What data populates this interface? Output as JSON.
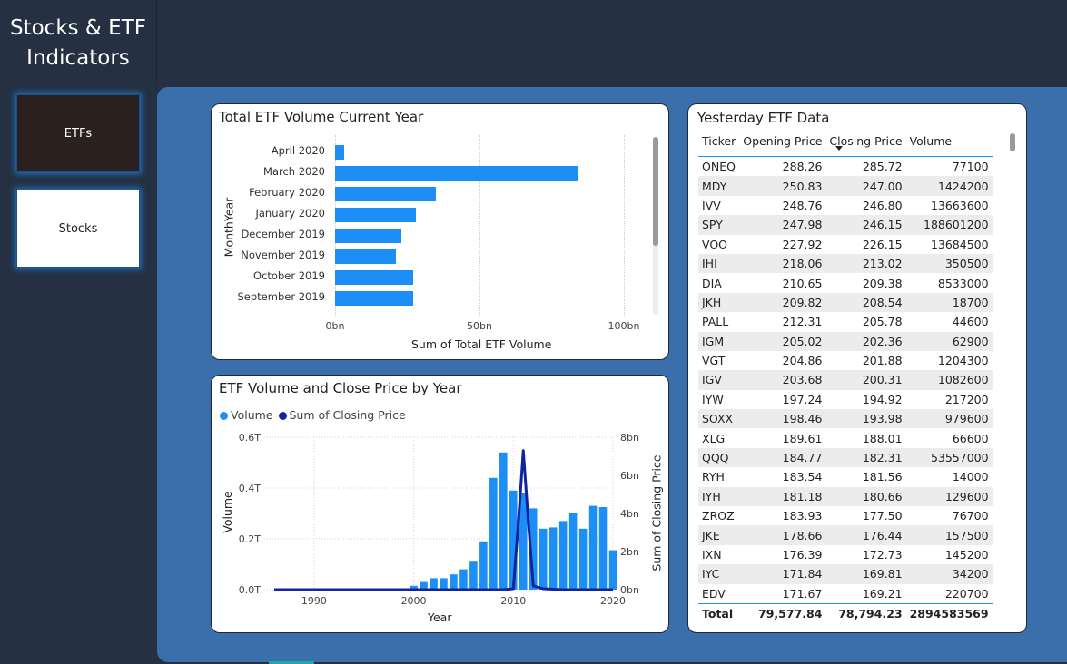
{
  "app": {
    "title": "Stocks & ETF\nIndicators"
  },
  "nav": {
    "etfs_label": "ETFs",
    "stocks_label": "Stocks"
  },
  "volume_chart": {
    "title": "Total ETF Volume Current Year",
    "chart_data": {
      "type": "bar",
      "orientation": "horizontal",
      "title": "Total ETF Volume Current Year",
      "ylabel": "MonthYear",
      "xlabel": "Sum of Total ETF Volume",
      "categories": [
        "April 2020",
        "March 2020",
        "February 2020",
        "January 2020",
        "December 2019",
        "November 2019",
        "October 2019",
        "September 2019"
      ],
      "values": [
        3,
        84,
        35,
        28,
        23,
        21,
        27,
        27
      ],
      "value_unit": "bn",
      "xlim": [
        0,
        100
      ],
      "ticks": [
        "0bn",
        "50bn",
        "100bn"
      ],
      "grid": true
    }
  },
  "combo_chart": {
    "title": "ETF Volume and Close Price by Year",
    "chart_data": {
      "type": "bar",
      "title": "ETF Volume and Close Price by Year",
      "xlabel": "Year",
      "ylabel": "Volume",
      "y2label": "Sum of Closing Price",
      "legend": [
        "Volume",
        "Sum of Closing Price"
      ],
      "legend_position": "top-left",
      "xlim": [
        1985,
        2020
      ],
      "ylim": [
        0,
        0.6
      ],
      "y2lim": [
        0,
        8
      ],
      "x_ticks": [
        "1990",
        "2000",
        "2010",
        "2020"
      ],
      "y_ticks": [
        "0.0T",
        "0.2T",
        "0.4T",
        "0.6T"
      ],
      "y2_ticks": [
        "0bn",
        "2bn",
        "4bn",
        "6bn",
        "8bn"
      ],
      "series": [
        {
          "name": "Volume",
          "kind": "bar",
          "unit": "T",
          "x": [
            2000,
            2001,
            2002,
            2003,
            2004,
            2005,
            2006,
            2007,
            2008,
            2009,
            2010,
            2011,
            2012,
            2013,
            2014,
            2015,
            2016,
            2017,
            2018,
            2019,
            2020
          ],
          "values": [
            0.015,
            0.03,
            0.045,
            0.045,
            0.06,
            0.08,
            0.11,
            0.19,
            0.44,
            0.54,
            0.39,
            0.38,
            0.32,
            0.24,
            0.245,
            0.27,
            0.3,
            0.24,
            0.33,
            0.325,
            0.155
          ]
        },
        {
          "name": "Sum of Closing Price",
          "kind": "line",
          "unit": "bn",
          "x": [
            1986,
            1995,
            2000,
            2005,
            2008,
            2009,
            2010,
            2010.5,
            2011,
            2011.5,
            2012,
            2013,
            2015,
            2020
          ],
          "values": [
            0,
            0,
            0,
            0,
            0,
            0,
            0.05,
            3.5,
            7.3,
            3.6,
            0.2,
            0.05,
            0,
            0
          ]
        }
      ],
      "grid": true
    }
  },
  "etf_table": {
    "title": "Yesterday ETF Data",
    "columns": [
      "Ticker",
      "Opening Price",
      "Closing Price",
      "Volume"
    ],
    "rows": [
      [
        "ONEQ",
        "288.26",
        "285.72",
        "77100"
      ],
      [
        "MDY",
        "250.83",
        "247.00",
        "1424200"
      ],
      [
        "IVV",
        "248.76",
        "246.80",
        "13663600"
      ],
      [
        "SPY",
        "247.98",
        "246.15",
        "188601200"
      ],
      [
        "VOO",
        "227.92",
        "226.15",
        "13684500"
      ],
      [
        "IHI",
        "218.06",
        "213.02",
        "350500"
      ],
      [
        "DIA",
        "210.65",
        "209.38",
        "8533000"
      ],
      [
        "JKH",
        "209.82",
        "208.54",
        "18700"
      ],
      [
        "PALL",
        "212.31",
        "205.78",
        "44600"
      ],
      [
        "IGM",
        "205.02",
        "202.36",
        "62900"
      ],
      [
        "VGT",
        "204.86",
        "201.88",
        "1204300"
      ],
      [
        "IGV",
        "203.68",
        "200.31",
        "1082600"
      ],
      [
        "IYW",
        "197.24",
        "194.92",
        "217200"
      ],
      [
        "SOXX",
        "198.46",
        "193.98",
        "979600"
      ],
      [
        "XLG",
        "189.61",
        "188.01",
        "66600"
      ],
      [
        "QQQ",
        "184.77",
        "182.31",
        "53557000"
      ],
      [
        "RYH",
        "183.54",
        "181.56",
        "14000"
      ],
      [
        "IYH",
        "181.18",
        "180.66",
        "129600"
      ],
      [
        "ZROZ",
        "183.93",
        "177.50",
        "76700"
      ],
      [
        "JKE",
        "178.66",
        "176.44",
        "157500"
      ],
      [
        "IXN",
        "176.39",
        "172.73",
        "145200"
      ],
      [
        "IYC",
        "171.84",
        "169.81",
        "34200"
      ],
      [
        "EDV",
        "171.67",
        "169.21",
        "220700"
      ]
    ],
    "total": [
      "Total",
      "79,577.84",
      "78,794.23",
      "2894583569"
    ]
  },
  "colors": {
    "accent": "#1c8ef5",
    "line": "#12239e",
    "canvas": "#3b6fac",
    "dark": "#253142"
  }
}
